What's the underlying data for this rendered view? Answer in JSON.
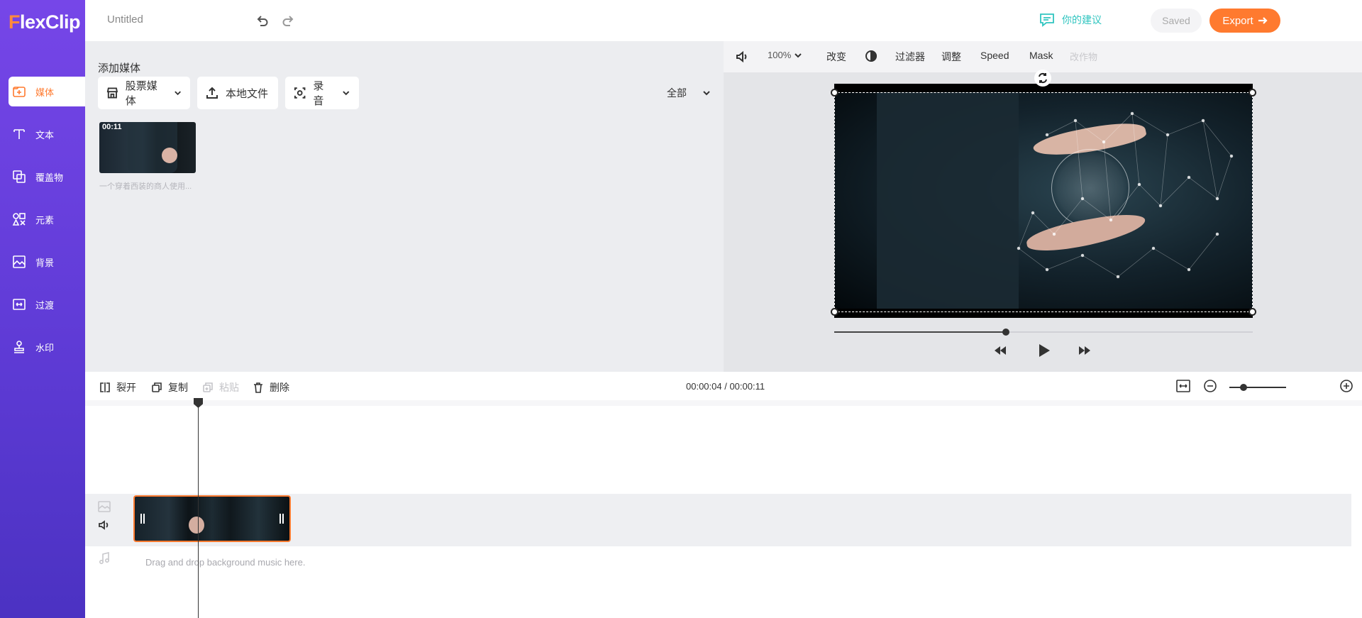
{
  "app": {
    "logo": "FlexClip"
  },
  "sidebar": {
    "items": [
      {
        "label": "媒体",
        "icon": "media-icon"
      },
      {
        "label": "文本",
        "icon": "text-icon"
      },
      {
        "label": "覆盖物",
        "icon": "overlay-icon"
      },
      {
        "label": "元素",
        "icon": "elements-icon"
      },
      {
        "label": "背景",
        "icon": "background-icon"
      },
      {
        "label": "过渡",
        "icon": "transition-icon"
      },
      {
        "label": "水印",
        "icon": "watermark-icon"
      }
    ],
    "active_index": 0
  },
  "header": {
    "title": "Untitled",
    "suggest_label": "你的建议",
    "saved_label": "Saved",
    "export_label": "Export"
  },
  "media": {
    "title": "添加媒体",
    "buttons": {
      "stock": "股票媒体",
      "local": "本地文件",
      "record": "录音"
    },
    "filter_label": "全部",
    "items": [
      {
        "duration": "00:11",
        "caption": "一个穿着西装的商人使用..."
      }
    ]
  },
  "preview": {
    "toolbar": {
      "zoom": "100%",
      "change": "改变",
      "filter": "过滤器",
      "adjust": "调整",
      "speed": "Speed",
      "mask": "Mask",
      "disabled_item": "改作物"
    },
    "progress": 0.41
  },
  "timeline": {
    "tools": {
      "split": "裂开",
      "copy": "复制",
      "paste": "粘贴",
      "delete": "删除"
    },
    "timecode": "00:00:04 / 00:00:11",
    "zoom_level": 0.25,
    "music_hint": "Drag and drop background music here."
  },
  "colors": {
    "accent": "#ff7a2f",
    "sidebar_top": "#7646e8",
    "sidebar_bottom": "#4b32c2",
    "suggest": "#30c5c0"
  }
}
